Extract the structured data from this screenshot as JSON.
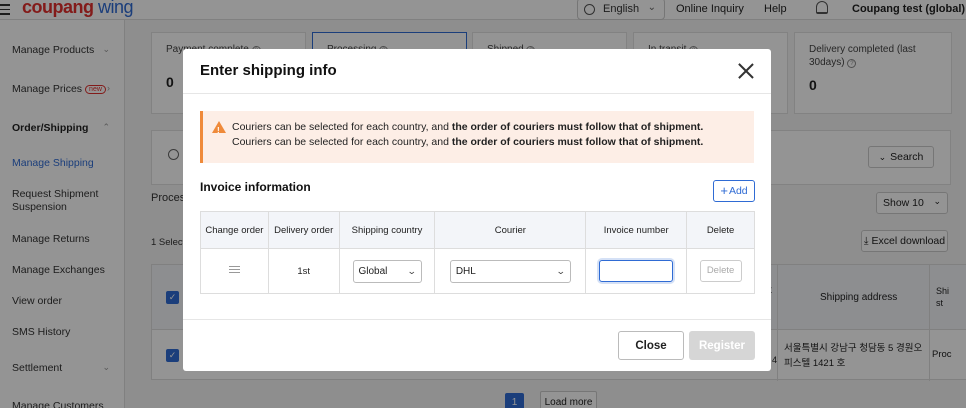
{
  "header": {
    "logo_brand": "coupang",
    "logo_product": "wing",
    "language": "English",
    "nav": [
      "Online Inquiry",
      "Help"
    ],
    "account": "Coupang test (global)"
  },
  "sidebar": {
    "items": [
      {
        "label": "Manage Products"
      },
      {
        "label": "Manage Prices",
        "badge": "new"
      },
      {
        "label": "Order/Shipping"
      },
      {
        "label": "Manage Shipping"
      },
      {
        "label": "Request Shipment Suspension"
      },
      {
        "label": "Manage Returns"
      },
      {
        "label": "Manage Exchanges"
      },
      {
        "label": "View order"
      },
      {
        "label": "SMS History"
      },
      {
        "label": "Settlement"
      },
      {
        "label": "Manage Customers"
      }
    ]
  },
  "status_cards": [
    {
      "label": "Payment complete",
      "count": "0"
    },
    {
      "label": "Processing",
      "count": ""
    },
    {
      "label": "Shipped",
      "count": ""
    },
    {
      "label": "In transit",
      "count": ""
    },
    {
      "label": "Delivery completed (last 30days)",
      "count": "0"
    }
  ],
  "background": {
    "search_label": "Search",
    "processing_partial": "Proces",
    "selected_partial": "1  Select",
    "show_select": "Show 10",
    "excel_download": "Excel download",
    "col_shipping_address": "Shipping address",
    "col_partial_t": "t",
    "col_partial_ship": "Shi st",
    "row_address": "서울특별시 강남구 청담동 5 경원오피스텔 1421 호",
    "row_partial_4": "4",
    "row_partial_proc": "Proc",
    "page": "1",
    "load_more": "Load more"
  },
  "modal": {
    "title": "Enter shipping info",
    "notice_lines": [
      {
        "prefix": "Couriers can be selected for each country, and ",
        "bold": "the order of couriers must follow that of shipment."
      },
      {
        "prefix": "Couriers can be selected for each country, and ",
        "bold": "the order of couriers must follow that of shipment."
      }
    ],
    "section_title": "Invoice information",
    "add_label": "Add",
    "table": {
      "headers": [
        "Change order",
        "Delivery order",
        "Shipping country",
        "Courier",
        "Invoice number",
        "Delete"
      ],
      "rows": [
        {
          "delivery_order": "1st",
          "shipping_country": "Global",
          "courier": "DHL",
          "invoice_number": "",
          "delete_label": "Delete"
        }
      ]
    },
    "close_label": "Close",
    "register_label": "Register"
  },
  "colors": {
    "accent": "#2f6bd4",
    "warning": "#ef8a3a",
    "notice_bg": "#fdeee6",
    "brand_red": "#e2302d"
  }
}
